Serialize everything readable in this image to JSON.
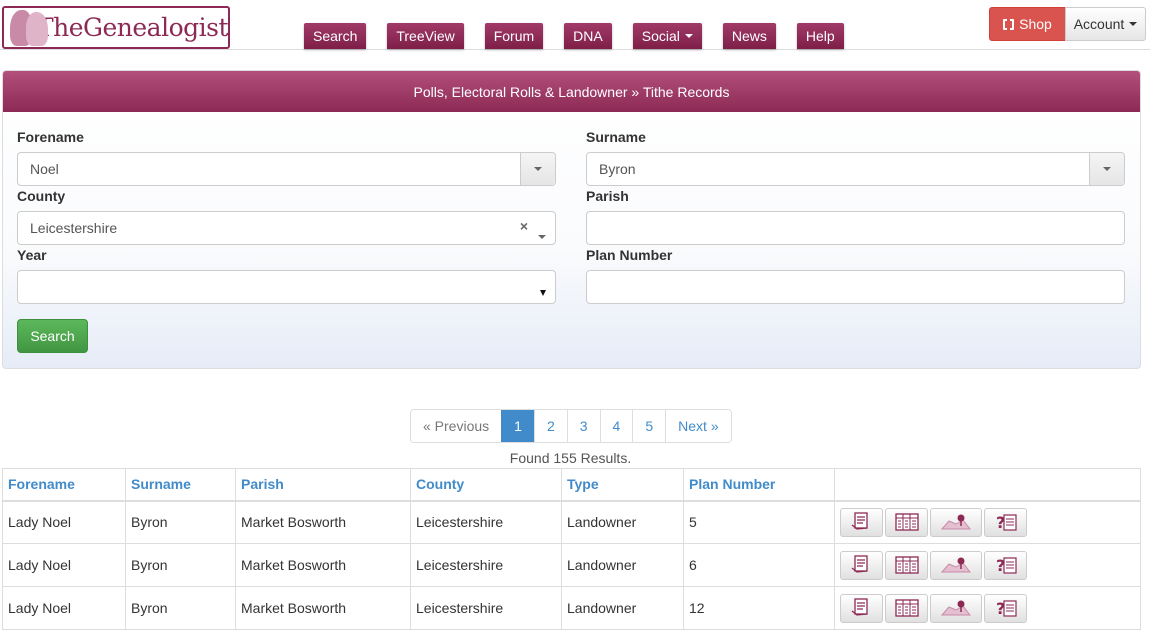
{
  "header": {
    "logo_text": "TheGenealogist",
    "nav": [
      {
        "label": "Search",
        "dropdown": false
      },
      {
        "label": "TreeView",
        "dropdown": false
      },
      {
        "label": "Forum",
        "dropdown": false
      },
      {
        "label": "DNA",
        "dropdown": false
      },
      {
        "label": "Social",
        "dropdown": true
      },
      {
        "label": "News",
        "dropdown": false
      },
      {
        "label": "Help",
        "dropdown": false
      }
    ],
    "shop_label": "Shop",
    "account_label": "Account"
  },
  "panel": {
    "title": "Polls, Electoral Rolls & Landowner » Tithe Records",
    "forename": {
      "label": "Forename",
      "value": "Noel"
    },
    "surname": {
      "label": "Surname",
      "value": "Byron"
    },
    "county": {
      "label": "County",
      "value": "Leicestershire"
    },
    "parish": {
      "label": "Parish",
      "value": ""
    },
    "year": {
      "label": "Year",
      "value": ""
    },
    "plan_number": {
      "label": "Plan Number",
      "value": ""
    },
    "search_label": "Search"
  },
  "pagination": {
    "previous": "« Previous",
    "pages": [
      "1",
      "2",
      "3",
      "4",
      "5"
    ],
    "active_page": "1",
    "next": "Next »"
  },
  "results_text": "Found 155 Results.",
  "table": {
    "columns": [
      "Forename",
      "Surname",
      "Parish",
      "County",
      "Type",
      "Plan Number",
      ""
    ],
    "rows": [
      [
        "Lady Noel",
        "Byron",
        "Market Bosworth",
        "Leicestershire",
        "Landowner",
        "5"
      ],
      [
        "Lady Noel",
        "Byron",
        "Market Bosworth",
        "Leicestershire",
        "Landowner",
        "6"
      ],
      [
        "Lady Noel",
        "Byron",
        "Market Bosworth",
        "Leicestershire",
        "Landowner",
        "12"
      ]
    ],
    "action_icons": [
      "transcript-icon",
      "record-image-icon",
      "map-icon",
      "help-icon"
    ]
  },
  "colors": {
    "brand": "#8c2a55",
    "shop": "#d9534f",
    "link": "#428bca",
    "search_button": "#5cb85c"
  }
}
